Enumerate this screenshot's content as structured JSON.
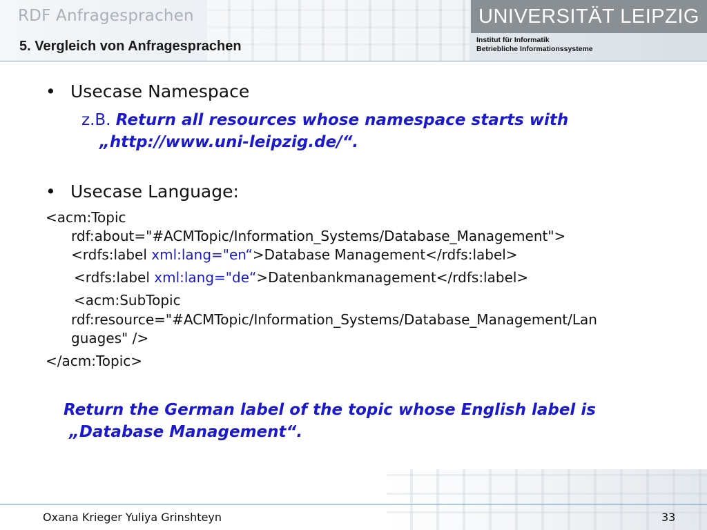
{
  "header": {
    "deck_title": "RDF Anfragesprachen",
    "slide_subtitle": "5.  Vergleich von Anfragesprachen",
    "logo_text": "UNIVERSITÄT LEIPZIG",
    "institute_line1": "Institut für Informatik",
    "institute_line2": "Betriebliche Informationssysteme"
  },
  "bullets": [
    {
      "marker": "•",
      "text": "Usecase Namespace"
    },
    {
      "marker": "•",
      "text": "Usecase Language:"
    }
  ],
  "namespace_example": {
    "prefix": "z.B.",
    "query_line1": "Return all resources whose namespace starts with",
    "query_line2": "„http://www.uni-leipzig.de/“."
  },
  "code": {
    "l1": "<acm:Topic",
    "l2": "rdf:about=\"#ACMTopic/Information_Systems/Database_Management\">",
    "l3_a": "<rdfs:label ",
    "l3_b": "xml:lang=\"en“",
    "l3_c": ">Database Management</rdfs:label>",
    "l4_a": "<rdfs:label ",
    "l4_b": "xml:lang=\"de“",
    "l4_c": ">Datenbankmanagement</rdfs:label>",
    "l5": "<acm:SubTopic",
    "l6": "rdf:resource=\"#ACMTopic/Information_Systems/Database_Management/Lan",
    "l7": "guages\" />",
    "l8": "</acm:Topic>"
  },
  "closing_query": {
    "line1": "Return the German label of the topic whose English label is",
    "line2": "„Database Management“."
  },
  "footer": {
    "authors": "Oxana Krieger  Yuliya Grinshteyn",
    "page_number": "33"
  },
  "colors": {
    "accent_blue": "#1a1acc",
    "logo_bg": "#8a8f94",
    "title_gray": "#a8b0b8"
  }
}
